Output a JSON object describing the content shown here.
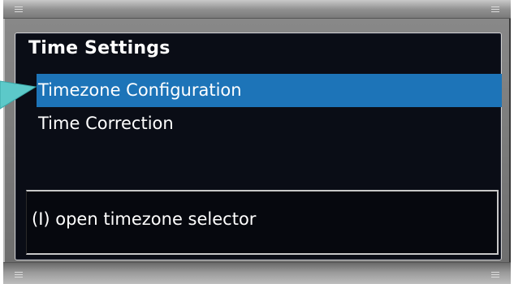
{
  "panel": {
    "title": "Time Settings",
    "menu_items": [
      {
        "label": "Timezone Configuration",
        "selected": true
      },
      {
        "label": "Time Correction",
        "selected": false
      }
    ],
    "hint": "(I) open timezone selector"
  },
  "colors": {
    "panel_background": "#0a0d16",
    "selection_highlight": "#1d74b8",
    "text": "#ffffff",
    "pointer": "#5cc9c9"
  },
  "pointer": {
    "icon": "pointer-arrow-icon"
  }
}
